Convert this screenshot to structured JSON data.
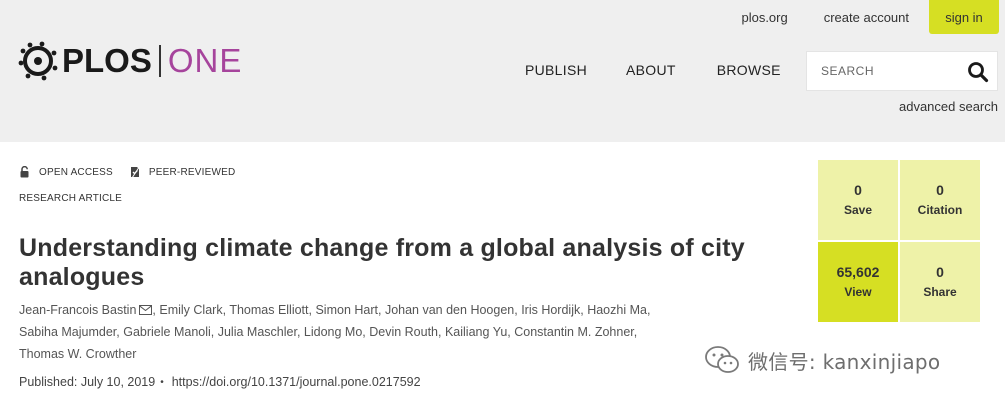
{
  "utility_nav": {
    "plos_link": "plos.org",
    "create_account": "create account",
    "sign_in": "sign in"
  },
  "brand": {
    "plos": "PLOS",
    "one": "ONE",
    "one_color": "#a6449c",
    "accent_color": "#d6df23"
  },
  "main_nav": {
    "publish": "PUBLISH",
    "about": "ABOUT",
    "browse": "BROWSE"
  },
  "search": {
    "placeholder": "SEARCH",
    "icon": "search-icon",
    "advanced": "advanced search"
  },
  "article": {
    "open_access": "OPEN ACCESS",
    "peer_reviewed": "PEER-REVIEWED",
    "type": "RESEARCH ARTICLE",
    "title": "Understanding climate change from a global analysis of city analogues",
    "authors": [
      "Jean-Francois Bastin",
      "Emily Clark",
      "Thomas Elliott",
      "Simon Hart",
      "Johan van den Hoogen",
      "Iris Hordijk",
      "Haozhi Ma",
      "Sabiha Majumder",
      "Gabriele Manoli",
      "Julia Maschler",
      "Lidong Mo",
      "Devin Routh",
      "Kailiang Yu",
      "Constantin M. Zohner",
      "Thomas W. Crowther"
    ],
    "published": "Published: July 10, 2019",
    "bullet": "•",
    "doi": "https://doi.org/10.1371/journal.pone.0217592"
  },
  "metrics": {
    "save": {
      "count": "0",
      "label": "Save"
    },
    "citation": {
      "count": "0",
      "label": "Citation"
    },
    "view": {
      "count": "65,602",
      "label": "View"
    },
    "share": {
      "count": "0",
      "label": "Share"
    }
  },
  "watermark": {
    "text": "微信号: kanxinjiapo"
  }
}
